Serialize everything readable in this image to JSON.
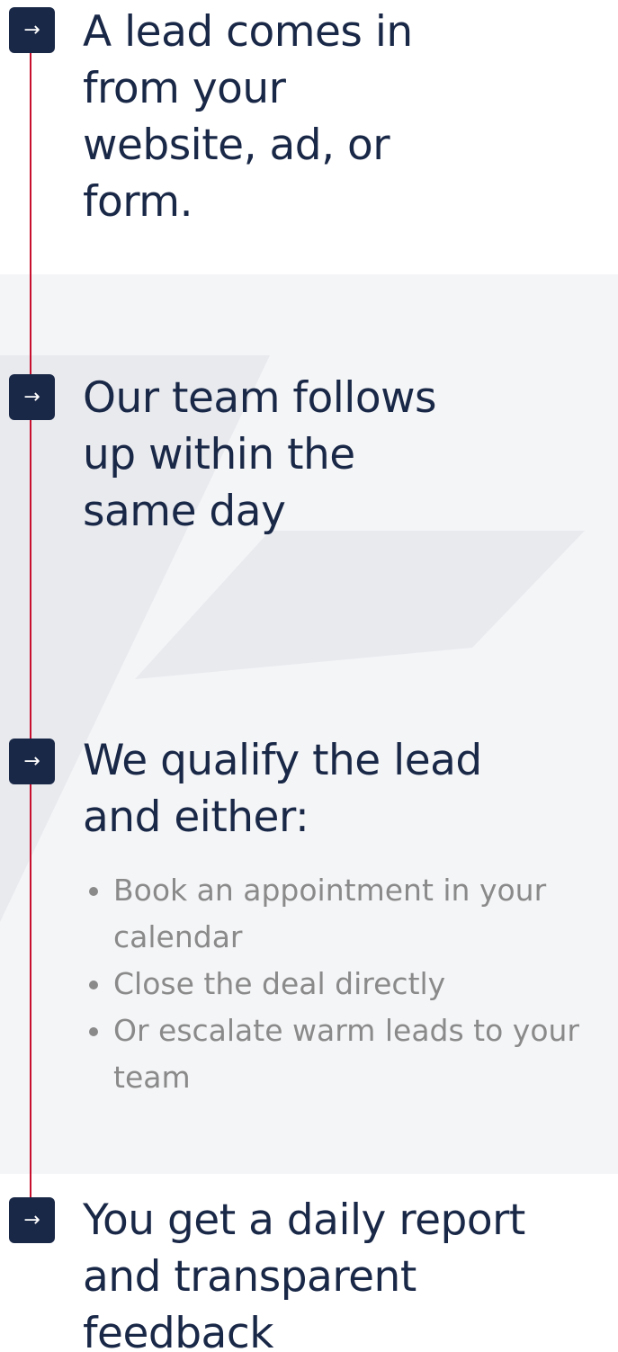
{
  "colors": {
    "navy": "#1a2847",
    "accent_red": "#c8102e",
    "muted_text": "#8a8a8a",
    "watermark": "#eef0f3"
  },
  "steps": [
    {
      "icon": "arrow-right-icon",
      "marker": "→",
      "title_lines": [
        "A lead comes in",
        "from your",
        "website, ad, or",
        "form."
      ]
    },
    {
      "icon": "arrow-right-icon",
      "marker": "→",
      "title_lines": [
        "Our team follows",
        "up within the",
        "same day"
      ]
    },
    {
      "icon": "arrow-right-icon",
      "marker": "→",
      "title_lines": [
        "We qualify the lead",
        "and either:"
      ],
      "options": [
        "Book an appointment in your calendar",
        "Close the deal directly",
        "Or escalate warm leads to your team"
      ]
    },
    {
      "icon": "arrow-right-icon",
      "marker": "→",
      "title_lines": [
        "You get a daily report",
        "and transparent",
        "feedback"
      ]
    }
  ]
}
